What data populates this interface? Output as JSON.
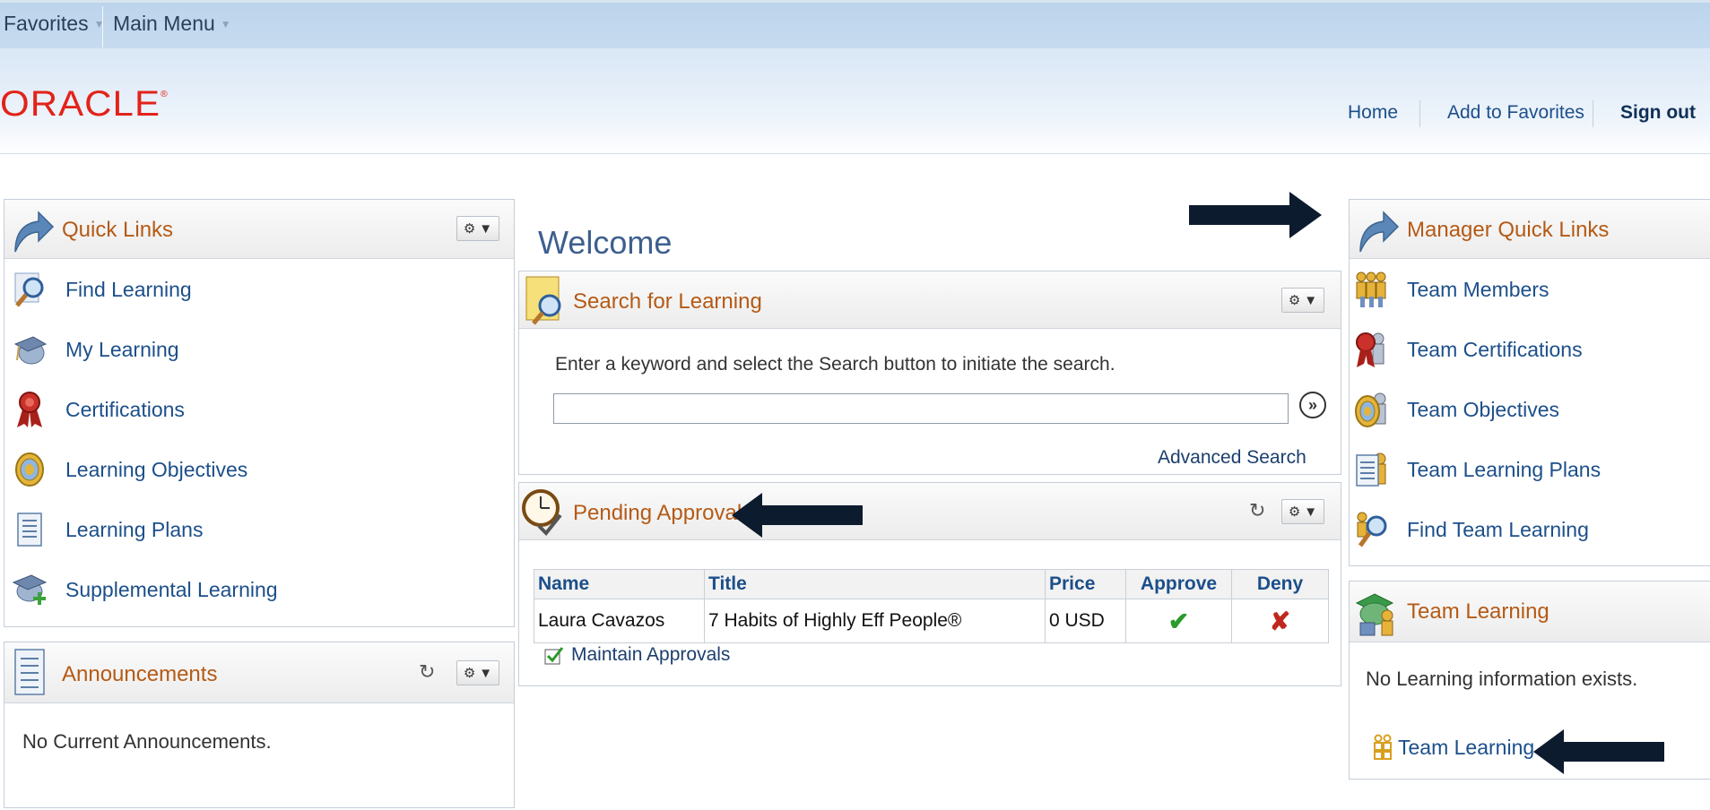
{
  "menubar": {
    "favorites": "Favorites",
    "main_menu": "Main Menu"
  },
  "header": {
    "logo": "ORACLE",
    "links": {
      "home": "Home",
      "add_favorites": "Add to Favorites",
      "sign_out": "Sign out"
    }
  },
  "welcome": "Welcome",
  "quick_links": {
    "title": "Quick Links",
    "items": [
      {
        "label": "Find Learning",
        "icon": "magnifier-icon"
      },
      {
        "label": "My Learning",
        "icon": "graduation-cap-icon"
      },
      {
        "label": "Certifications",
        "icon": "ribbon-award-icon"
      },
      {
        "label": "Learning Objectives",
        "icon": "target-icon"
      },
      {
        "label": "Learning Plans",
        "icon": "checklist-icon"
      },
      {
        "label": "Supplemental Learning",
        "icon": "cap-add-icon"
      }
    ]
  },
  "announcements": {
    "title": "Announcements",
    "empty": "No Current Announcements."
  },
  "search": {
    "title": "Search for Learning",
    "instructions": "Enter a keyword and select the Search button to initiate the search.",
    "input_value": "",
    "advanced": "Advanced Search"
  },
  "pending": {
    "title": "Pending Approvals",
    "columns": [
      "Name",
      "Title",
      "Price",
      "Approve",
      "Deny"
    ],
    "rows": [
      {
        "name": "Laura Cavazos",
        "title": "7 Habits of Highly Eff People®",
        "price": "0 USD"
      }
    ],
    "maintain": "Maintain Approvals"
  },
  "manager_links": {
    "title": "Manager Quick Links",
    "items": [
      {
        "label": "Team Members",
        "icon": "team-icon"
      },
      {
        "label": "Team Certifications",
        "icon": "team-ribbon-icon"
      },
      {
        "label": "Team Objectives",
        "icon": "team-target-icon"
      },
      {
        "label": "Team Learning Plans",
        "icon": "team-checklist-icon"
      },
      {
        "label": "Find Team Learning",
        "icon": "team-magnifier-icon"
      }
    ]
  },
  "team_learning": {
    "title": "Team Learning",
    "empty": "No Learning information exists.",
    "link": "Team Learning"
  },
  "colors": {
    "accent_orange": "#b55a15",
    "link_blue": "#1c4f8a",
    "oracle_red": "#e2231a",
    "arrow": "#0d1b2e"
  }
}
